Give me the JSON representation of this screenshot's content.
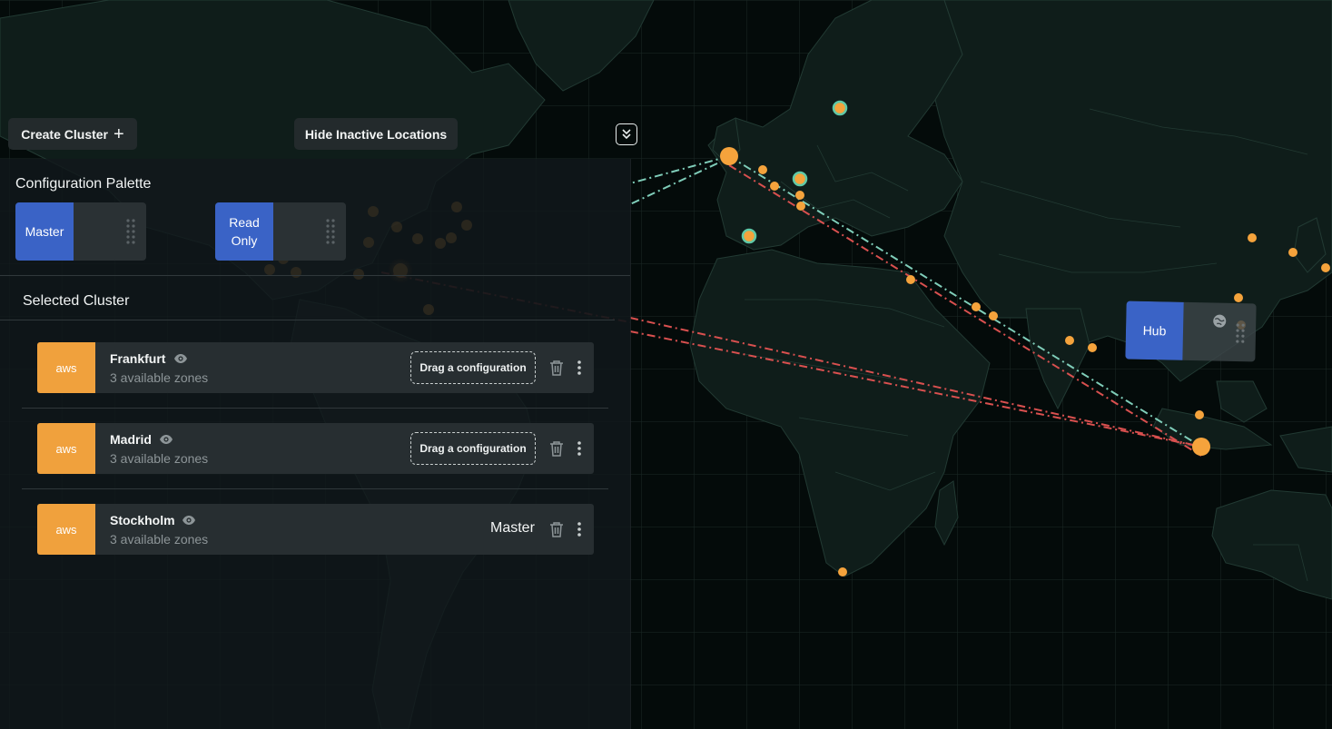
{
  "toolbar": {
    "create_cluster_label": "Create Cluster",
    "create_cluster_icon": "plus-icon",
    "hide_inactive_label": "Hide Inactive Locations",
    "collapse_icon": "double-chevron-down-icon"
  },
  "palette": {
    "title": "Configuration Palette",
    "items": [
      {
        "label": "Master"
      },
      {
        "label": "Read Only"
      }
    ]
  },
  "selected": {
    "title": "Selected Cluster",
    "clusters": [
      {
        "provider": "aws",
        "name": "Frankfurt",
        "zones": "3 available zones",
        "configuration": "Drag a configuration"
      },
      {
        "provider": "aws",
        "name": "Madrid",
        "zones": "3 available zones",
        "configuration": "Drag a configuration"
      },
      {
        "provider": "aws",
        "name": "Stockholm",
        "zones": "3 available zones",
        "configuration": "Master"
      }
    ]
  },
  "map": {
    "hub_label": "Hub"
  },
  "colors": {
    "accent_blue": "#3a63c6",
    "aws_orange": "#f0a13d",
    "location_dot": "#f5a33c",
    "active_ring": "#5fc9a7",
    "link_teal": "#7fcdb9",
    "link_red": "#d9504f",
    "map_background": "#040b0a"
  }
}
